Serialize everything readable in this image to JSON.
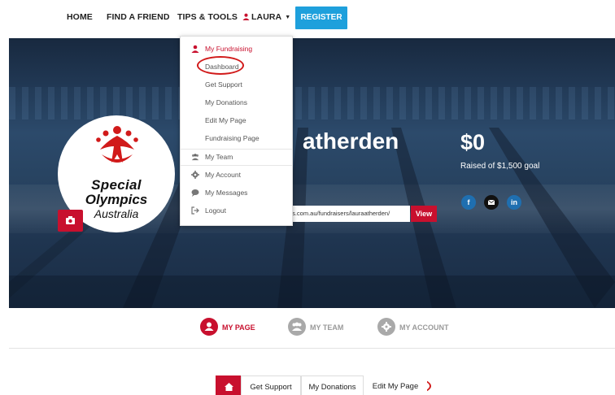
{
  "nav": {
    "home": "HOME",
    "find_friend": "FIND A FRIEND",
    "tips_tools": "TIPS & TOOLS",
    "user": "LAURA",
    "register": "REGISTER"
  },
  "dropdown": {
    "header": "My Fundraising",
    "items": [
      "Dashboard",
      "Get Support",
      "My Donations",
      "Edit My Page",
      "Fundraising Page"
    ],
    "account_items": [
      "My Team",
      "My Account",
      "My Messages",
      "Logout"
    ]
  },
  "hero": {
    "name_partial": "atherden",
    "raised": "$0",
    "goal_text": "Raised of $1,500 goal",
    "url": "ts.com.au/fundraisers/lauraatherden/",
    "view_label": "View"
  },
  "logo": {
    "line1": "Special",
    "line2": "Olympics",
    "line3": "Australia"
  },
  "profile_tabs": [
    "MY PAGE",
    "MY TEAM",
    "MY ACCOUNT"
  ],
  "bottom_tabs": [
    "Get Support",
    "My Donations",
    "Edit My Page"
  ],
  "colors": {
    "brand_red": "#c8102e",
    "register_blue": "#1ea0dc",
    "annotation_red": "#d11a1a"
  }
}
